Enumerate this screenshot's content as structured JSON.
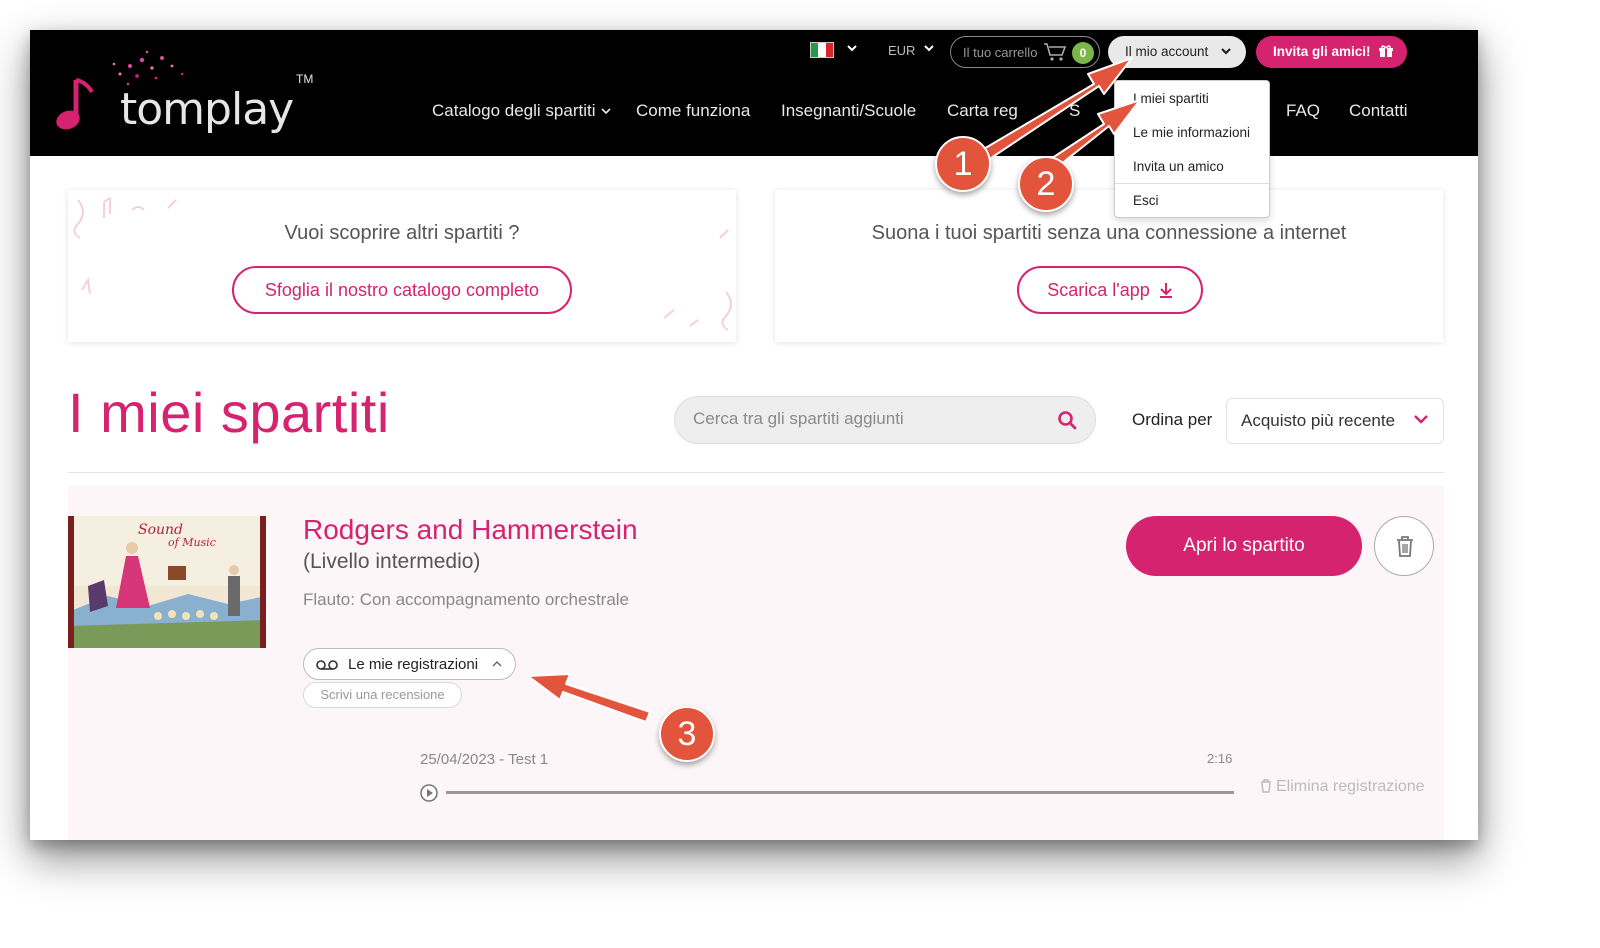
{
  "brand": {
    "name": "tomplay",
    "trademark": "TM"
  },
  "header": {
    "currency": "EUR",
    "cart": {
      "label": "Il tuo carrello",
      "count": "0"
    },
    "account_label": "Il mio account",
    "invite_label": "Invita gli amici!",
    "nav": [
      {
        "label": "Catalogo degli spartiti"
      },
      {
        "label": "Come funziona"
      },
      {
        "label": "Insegnanti/Scuole"
      },
      {
        "label": "Carta reg"
      },
      {
        "label": "S"
      },
      {
        "label": "FAQ"
      },
      {
        "label": "Contatti"
      }
    ],
    "account_menu": [
      "I miei spartiti",
      "Le mie informazioni",
      "Invita un amico",
      "Esci"
    ]
  },
  "promo": {
    "catalog": {
      "title": "Vuoi scoprire altri spartiti ?",
      "button": "Sfoglia il nostro catalogo completo"
    },
    "app": {
      "title": "Suona i tuoi spartiti senza una connessione a internet",
      "button": "Scarica l'app"
    }
  },
  "main": {
    "title": "I miei spartiti",
    "search_placeholder": "Cerca tra gli spartiti aggiunti",
    "sort_label": "Ordina per",
    "sort_value": "Acquisto più recente",
    "items": [
      {
        "title": "Rodgers and Hammerstein",
        "level": "(Livello intermedio)",
        "instrument": "Flauto: Con accompagnamento orchestrale",
        "recordings_label": "Le mie registrazioni",
        "review_label": "Scrivi una recensione",
        "open_label": "Apri lo spartito",
        "recordings": [
          {
            "title": "25/04/2023 - Test 1",
            "duration": "2:16",
            "delete_label": "Elimina registrazione"
          }
        ]
      }
    ]
  },
  "annotations": [
    "1",
    "2",
    "3"
  ],
  "colors": {
    "accent": "#d6236f",
    "callout": "#e2543b",
    "cart_badge": "#7ab648"
  }
}
